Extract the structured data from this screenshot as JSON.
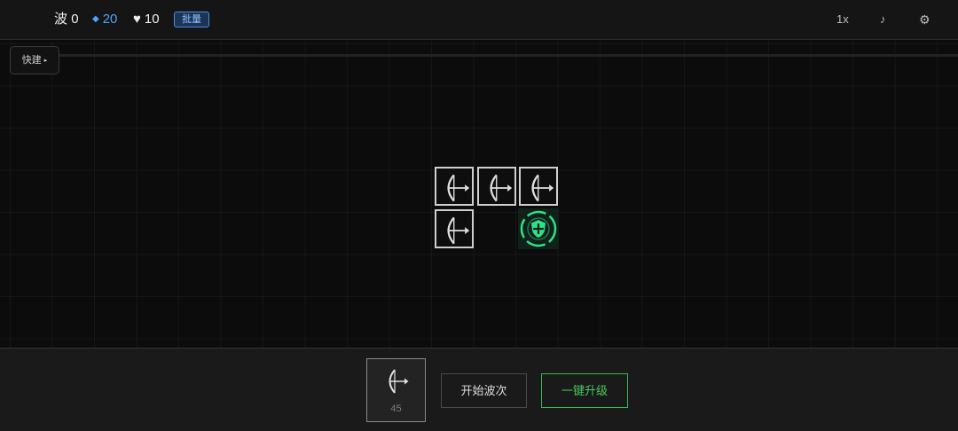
{
  "hud": {
    "wave_label": "波",
    "wave_value": "0",
    "crystal_icon": "◆",
    "crystal_value": "20",
    "lives_icon": "♥",
    "lives_value": "10",
    "batch_label": "批量",
    "speed_label": "1x",
    "music_icon": "♪",
    "settings_icon": "⚙"
  },
  "map": {
    "quick_build_label": "快建",
    "quick_build_caret": "▸",
    "towers": [
      {
        "type": "bow",
        "col": 0,
        "row": 0
      },
      {
        "type": "bow",
        "col": 1,
        "row": 0
      },
      {
        "type": "bow",
        "col": 2,
        "row": 0
      },
      {
        "type": "bow",
        "col": 0,
        "row": 1
      }
    ],
    "core": {
      "col": 2,
      "row": 1,
      "icon": "shield-plus"
    }
  },
  "build_panel": {
    "card_icon": "bow",
    "card_cost": "45",
    "start_wave_label": "开始波次",
    "upgrade_all_label": "一键升级"
  },
  "colors": {
    "accent_blue": "#4ea3ff",
    "accent_green": "#49c95e",
    "core_green": "#2ee08a"
  }
}
